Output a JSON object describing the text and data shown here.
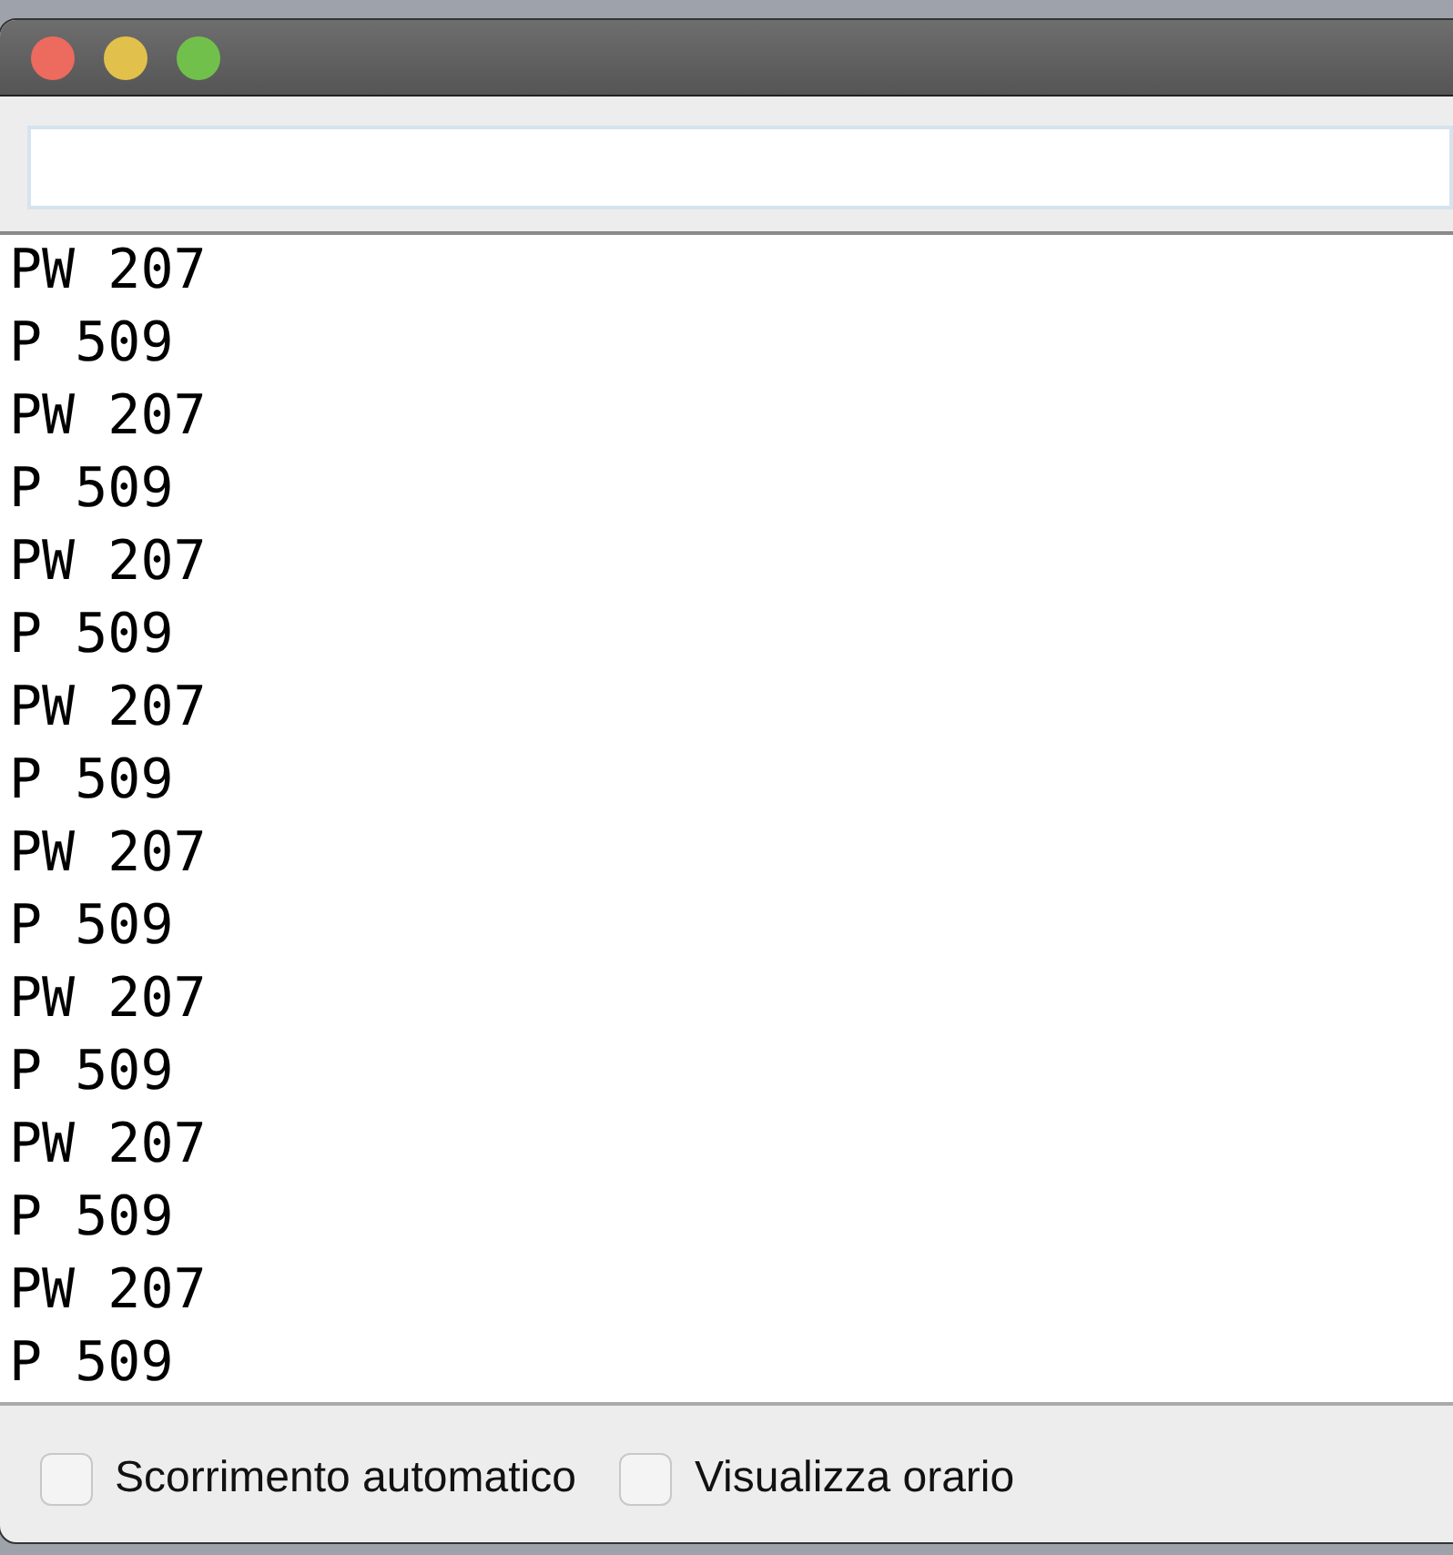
{
  "output_lines": [
    "PW 207",
    "P 509",
    "PW 207",
    "P 509",
    "PW 207",
    "P 509",
    "PW 207",
    "P 509",
    "PW 207",
    "P 509",
    "PW 207",
    "P 509",
    "PW 207",
    "P 509",
    "PW 207",
    "P 509"
  ],
  "options": [
    {
      "label": "Scorrimento automatico",
      "checked": false
    },
    {
      "label": "Visualizza orario",
      "checked": false
    }
  ]
}
